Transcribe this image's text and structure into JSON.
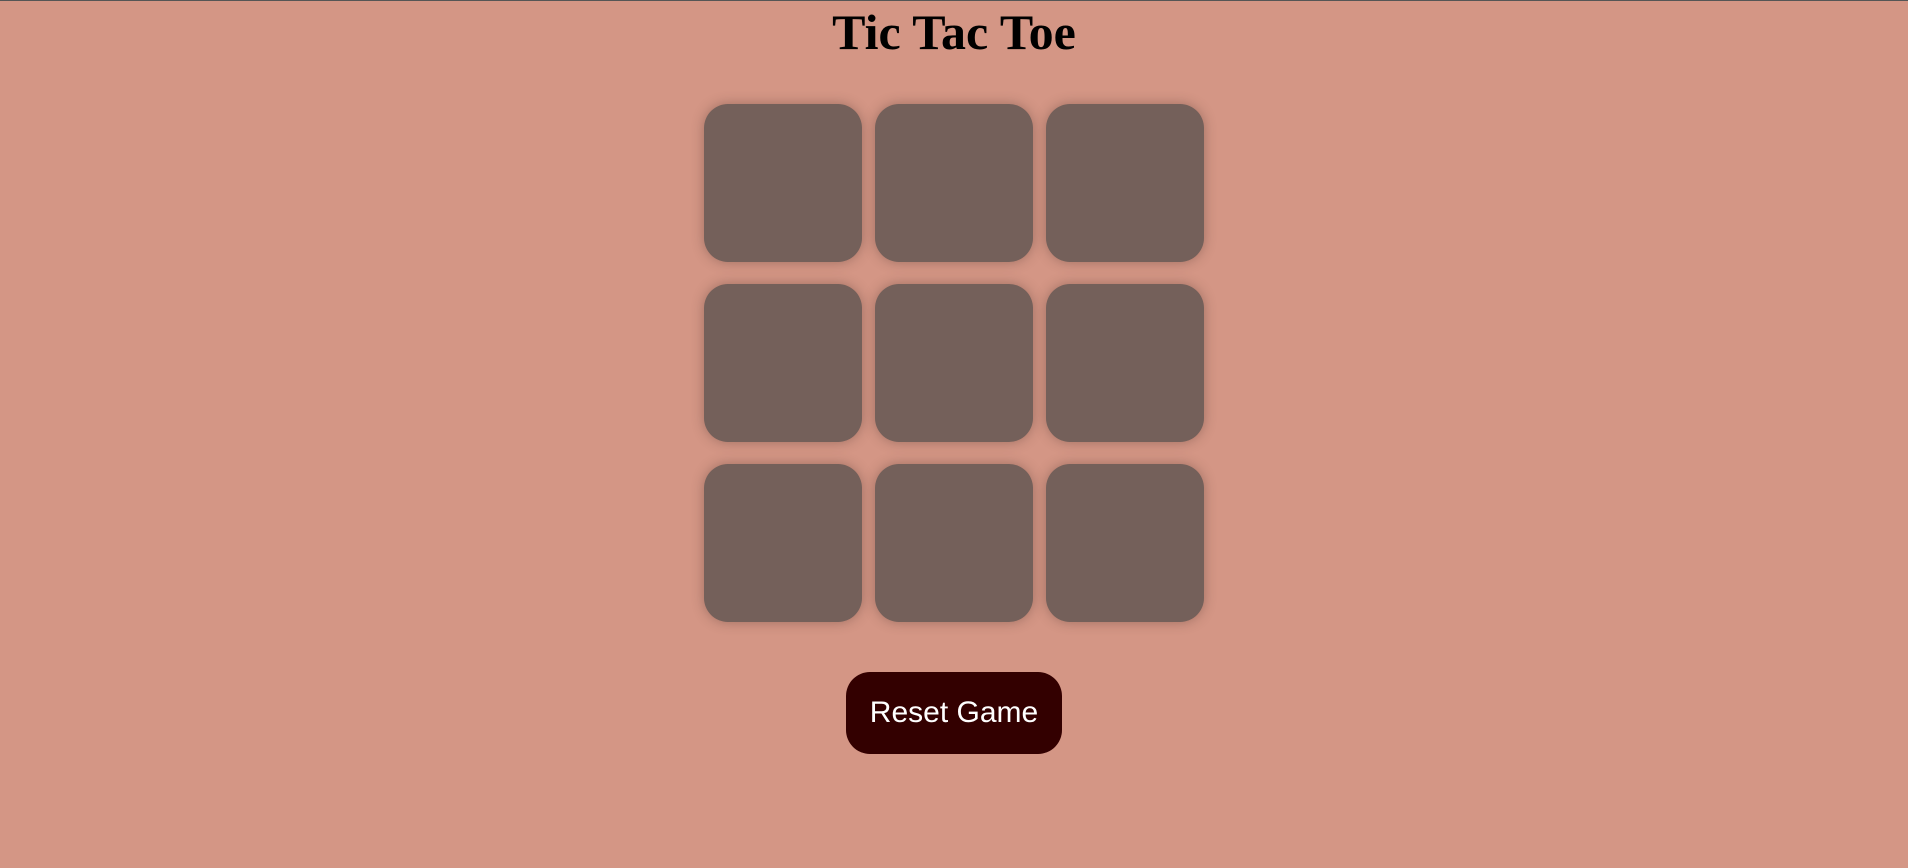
{
  "page": {
    "title": "Tic Tac Toe",
    "background_color": "#d49685"
  },
  "board": {
    "cells": [
      "",
      "",
      "",
      "",
      "",
      "",
      "",
      "",
      ""
    ],
    "cell_color": "#74605a"
  },
  "controls": {
    "reset_label": "Reset Game",
    "reset_color": "#330000"
  }
}
